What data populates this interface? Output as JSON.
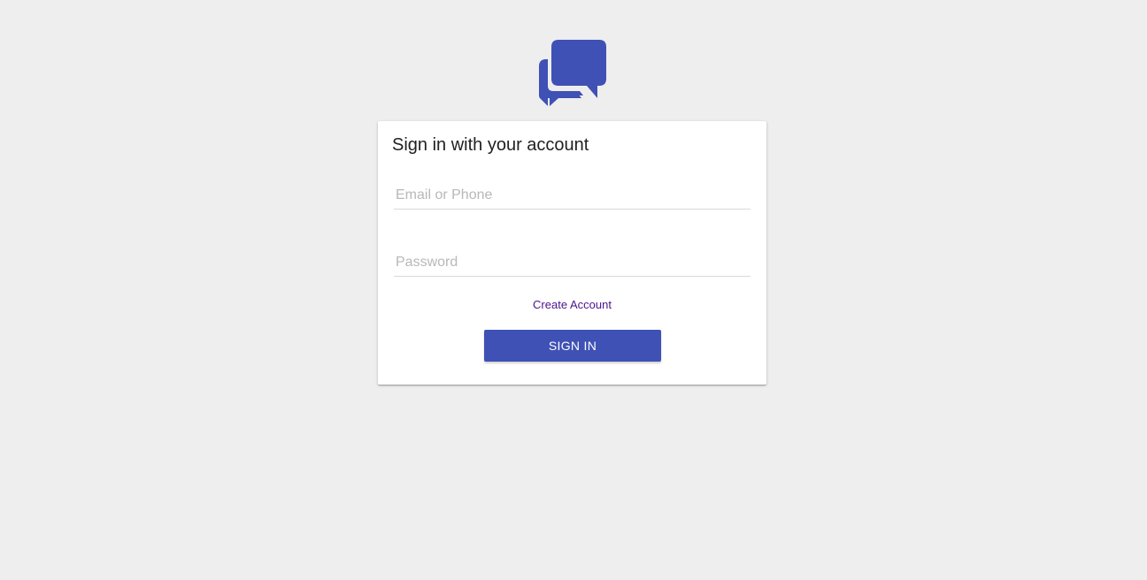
{
  "logo": {
    "icon": "chat-bubbles-icon",
    "color": "#3f51b5"
  },
  "card": {
    "title": "Sign in with your account"
  },
  "form": {
    "email_placeholder": "Email or Phone",
    "password_placeholder": "Password",
    "create_account_label": "Create Account",
    "sign_in_label": "SIGN IN"
  },
  "colors": {
    "background": "#eeeeee",
    "accent": "#3f51b5",
    "link": "#4a148c"
  }
}
